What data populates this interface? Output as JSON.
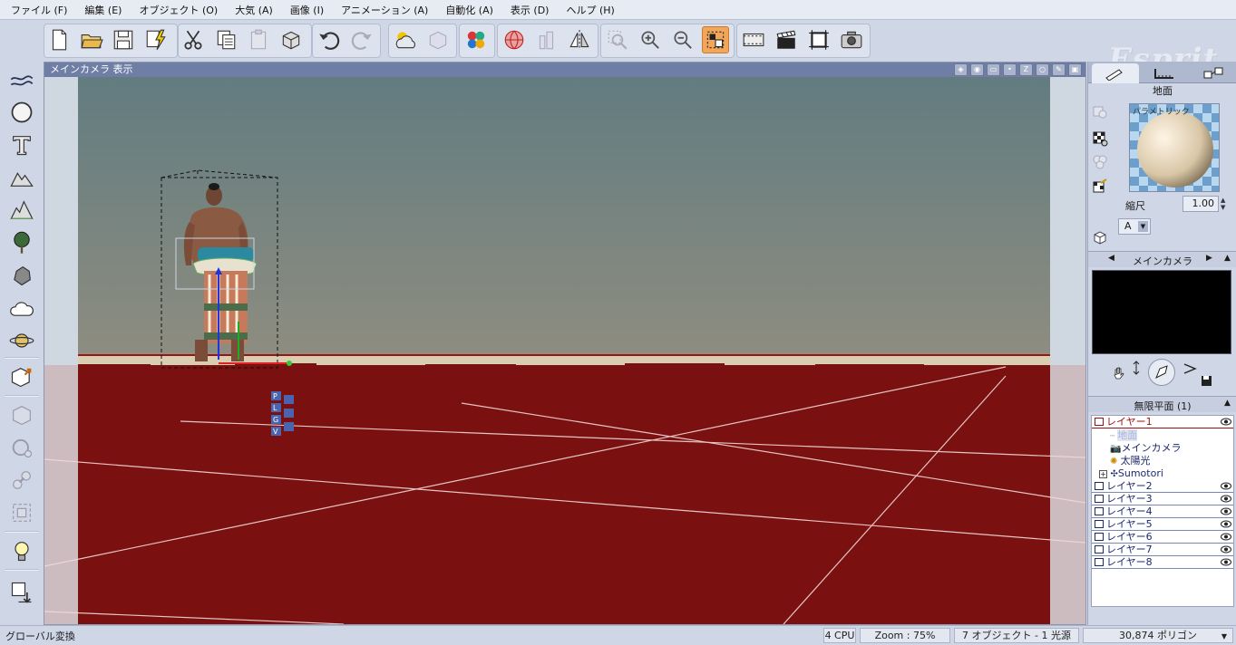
{
  "menu": [
    "ファイル (F)",
    "編集 (E)",
    "オブジェクト (O)",
    "大気 (A)",
    "画像 (I)",
    "アニメーション (A)",
    "自動化 (A)",
    "表示 (D)",
    "ヘルプ (H)"
  ],
  "brand": "Esprit",
  "viewport": {
    "title": "メインカメラ 表示",
    "gizmo_letters": [
      "P",
      "L",
      "G",
      "V"
    ]
  },
  "material_panel": {
    "header": "地面",
    "preview_label": "パラメトリック",
    "scale_label": "縮尺",
    "scale_value": "1.00",
    "mapping_value": "A"
  },
  "camera_panel": {
    "header": "メインカメラ"
  },
  "layers_panel": {
    "header": "無限平面 (1)",
    "layers": [
      "レイヤー1",
      "レイヤー2",
      "レイヤー3",
      "レイヤー4",
      "レイヤー5",
      "レイヤー6",
      "レイヤー7",
      "レイヤー8"
    ],
    "layer1_children": [
      "地面",
      "メインカメラ",
      "太陽光",
      "Sumotori"
    ]
  },
  "status": {
    "mode": "グローバル変換",
    "cpu": "4 CPU",
    "zoom": "Zoom : 75%",
    "objects": "7 オブジェクト - 1 光源",
    "polygons": "30,874 ポリゴン"
  },
  "colors": {
    "ground": "#7a1010",
    "sky_top": "#627c80",
    "sky_bottom": "#8e8d80",
    "accent": "#f2a65a",
    "title_bar": "#6e7ea5"
  }
}
